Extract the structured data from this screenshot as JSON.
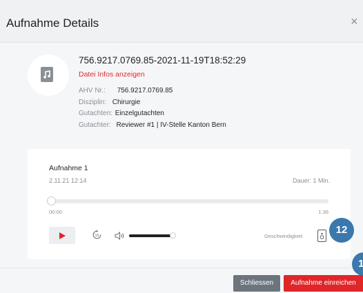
{
  "header": {
    "title": "Aufnahme Details",
    "close_label": "×"
  },
  "recording": {
    "title": "756.9217.0769.85-2021-11-19T18:52:29",
    "info_link": "Datei Infos anzeigen",
    "meta": [
      {
        "key": "AHV Nr.:",
        "value": "756.9217.0769.85"
      },
      {
        "key": "Disziplin:",
        "value": "Chirurgie"
      },
      {
        "key": "Gutachten:",
        "value": "Einzelgutachten"
      },
      {
        "key": "Gutachter:",
        "value": "Reviewer #1 | IV-Stelle Kanton Bern"
      }
    ]
  },
  "player": {
    "title": "Aufnahme 1",
    "date": "2.11.21 12:14",
    "duration": "Dauer: 1 Min.",
    "current_time": "00:00",
    "total_time": "1:36",
    "progress": 0.0,
    "volume": 1.0,
    "speed_label": "Geschwindigkeit:",
    "icons": {
      "play": "play-icon",
      "skip": "skip-15-icon",
      "volume": "volume-icon",
      "speed": "speed-icon"
    }
  },
  "annotations": {
    "badge_main": "12",
    "badge_partial": "1"
  },
  "footer": {
    "close_button": "Schliessen",
    "submit_button": "Aufnahme einreichen"
  },
  "colors": {
    "accent_red": "#df2629",
    "badge_blue": "#3a78ad",
    "secondary_gray": "#6c757d"
  }
}
